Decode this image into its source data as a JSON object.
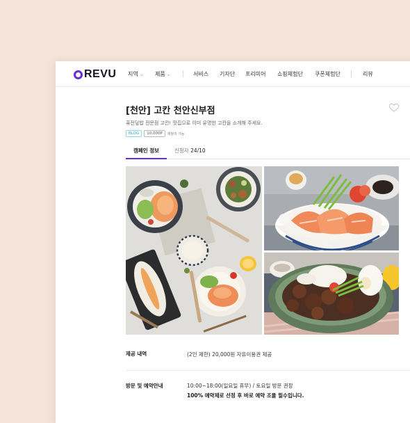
{
  "nav": {
    "logo_text": "REVU",
    "items": [
      {
        "label": "지역",
        "chevron": true
      },
      {
        "label": "제품",
        "chevron": true
      },
      {
        "label": "서비스"
      },
      {
        "label": "기자단"
      },
      {
        "label": "프리미어"
      },
      {
        "label": "쇼핑체험단"
      },
      {
        "label": "쿠폰체험단"
      },
      {
        "label": "리뷰"
      }
    ]
  },
  "campaign": {
    "title": "[천안] 고칸 천안신부점",
    "subtitle": "퓨전덮밥 전문점 고칸! 맛집으로 이미 유명한 고칸을 소개해 주세요.",
    "tags": {
      "blog": "BLOG",
      "point": "10,000P",
      "note": "재참여 가능"
    }
  },
  "tabs": {
    "info": "캠페인 정보",
    "applicants_label": "신청자",
    "applicants_count": "24/10"
  },
  "details": [
    {
      "label": "제공 내역",
      "lines": [
        "(2인 제한) 20,000원 자유이용권 제공"
      ]
    },
    {
      "label": "방문 및 예약안내",
      "lines": [
        "10:00~18:00(일요일 휴무) / 토요일 방문 권장",
        "100% 예약제로 선정 후 바로 예약 조율 필수입니다."
      ]
    }
  ],
  "colors": {
    "accent": "#6c2bd9",
    "background": "#f3e3d8",
    "tag_blog": "#2aa6c8"
  }
}
